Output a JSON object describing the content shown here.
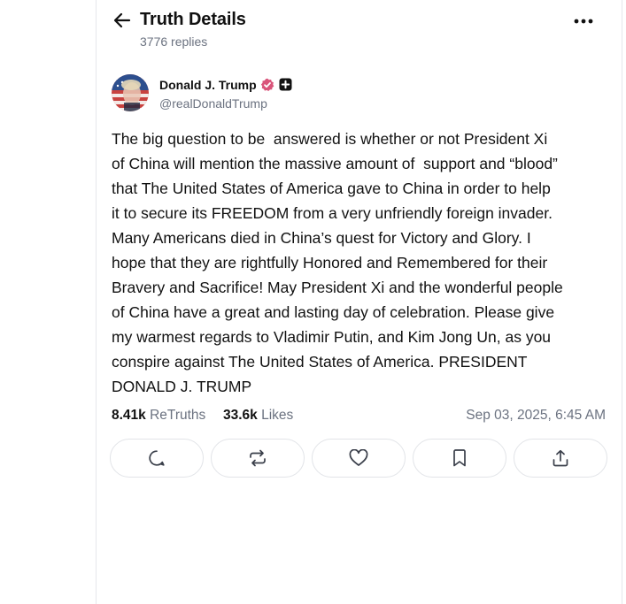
{
  "header": {
    "title": "Truth Details",
    "replies": "3776 replies",
    "back_icon": "arrow-left-icon",
    "more_icon": "more-horizontal-icon"
  },
  "author": {
    "name": "Donald J. Trump",
    "handle": "@realDonaldTrump",
    "verified_color": "#d9547a"
  },
  "post": {
    "lines": [
      "The big question to be  answered is whether or not President Xi",
      "of China will mention the massive amount of  support and “blood”",
      "that The United States of America gave to China in order to help",
      "it to secure its FREEDOM from a very unfriendly foreign invader.",
      "Many Americans died in China’s quest for Victory and Glory. I",
      "hope that they are rightfully Honored and Remembered for their",
      "Bravery and Sacrifice! May President Xi and the wonderful people",
      "of China have a great and lasting day of celebration. Please give",
      "my warmest regards to Vladimir Putin, and Kim Jong Un, as you",
      "conspire against The United States of America. PRESIDENT",
      "DONALD J. TRUMP"
    ]
  },
  "stats": {
    "retruths_count": "8.41k",
    "retruths_label": "ReTruths",
    "likes_count": "33.6k",
    "likes_label": "Likes",
    "timestamp": "Sep 03, 2025, 6:45 AM"
  },
  "actions": [
    "reply-icon",
    "retruth-icon",
    "like-icon",
    "bookmark-icon",
    "share-icon"
  ],
  "colors": {
    "text": "#111111",
    "muted": "#6b7280",
    "border": "#e2e4e8"
  }
}
